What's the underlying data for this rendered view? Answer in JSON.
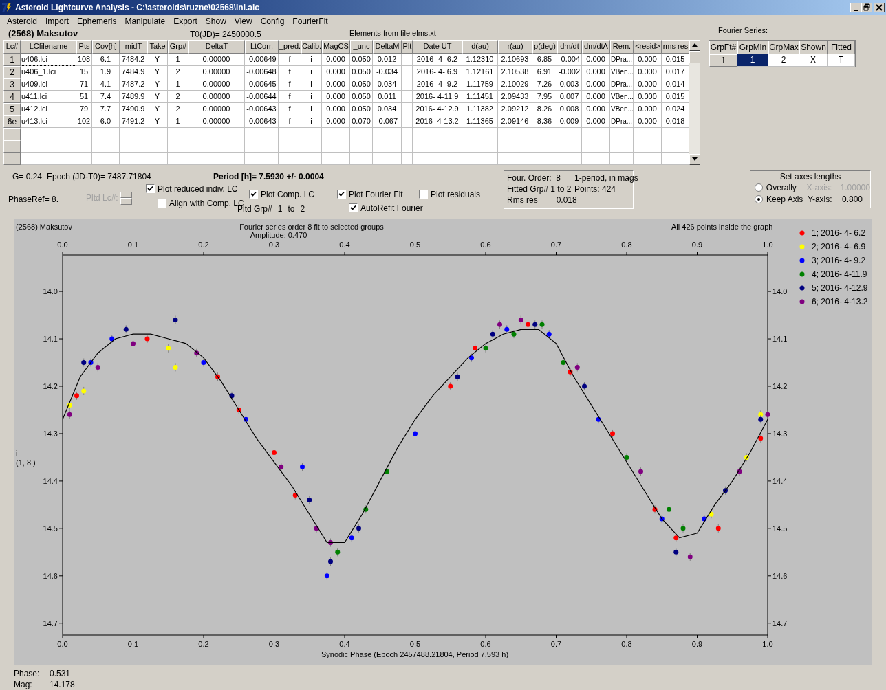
{
  "window": {
    "title": "Asteroid Lightcurve Analysis - C:\\asteroids\\ruzne\\02568\\ini.alc"
  },
  "menu": [
    "Asteroid",
    "Import",
    "Ephemeris",
    "Manipulate",
    "Export",
    "Show",
    "View",
    "Config",
    "FourierFit"
  ],
  "header": {
    "object": "(2568) Maksutov",
    "t0": "T0(JD)= 2450000.5",
    "elements": "Elements from file elms.xt"
  },
  "lc_table": {
    "columns": [
      "Lc#",
      "LCfilename",
      "Pts",
      "Cov[h]",
      "midT",
      "Take",
      "Grp#",
      "DeltaT",
      "LtCorr.",
      "_pred.",
      "Calib.",
      "MagCS",
      "_unc",
      "DeltaM",
      "Plt",
      "Date UT",
      "d(au)",
      "r(au)",
      "p(deg)",
      "dm/dt",
      "dm/dtA",
      "Rem.",
      "<resid>",
      "rms res"
    ],
    "rows": [
      {
        "focused": true,
        "cells": [
          "1",
          "u406.lci",
          "108",
          "6.1",
          "7484.2",
          "Y",
          "1",
          "0.00000",
          "-0.00649",
          "f",
          "i",
          "0.000",
          "0.050",
          "0.012",
          "",
          "2016- 4- 6.2",
          "1.12310",
          "2.10693",
          "6.85",
          "-0.004",
          "0.000",
          "DPra...",
          "0.000",
          "0.015"
        ]
      },
      {
        "focused": false,
        "cells": [
          "2",
          "u406_1.lci",
          "15",
          "1.9",
          "7484.9",
          "Y",
          "2",
          "0.00000",
          "-0.00648",
          "f",
          "i",
          "0.000",
          "0.050",
          "-0.034",
          "",
          "2016- 4- 6.9",
          "1.12161",
          "2.10538",
          "6.91",
          "-0.002",
          "0.000",
          "VBen...",
          "0.000",
          "0.017"
        ]
      },
      {
        "focused": false,
        "cells": [
          "3",
          "u409.lci",
          "71",
          "4.1",
          "7487.2",
          "Y",
          "1",
          "0.00000",
          "-0.00645",
          "f",
          "i",
          "0.000",
          "0.050",
          "0.034",
          "",
          "2016- 4- 9.2",
          "1.11759",
          "2.10029",
          "7.26",
          "0.003",
          "0.000",
          "DPra...",
          "0.000",
          "0.014"
        ]
      },
      {
        "focused": false,
        "cells": [
          "4",
          "u411.lci",
          "51",
          "7.4",
          "7489.9",
          "Y",
          "2",
          "0.00000",
          "-0.00644",
          "f",
          "i",
          "0.000",
          "0.050",
          "0.011",
          "",
          "2016- 4-11.9",
          "1.11451",
          "2.09433",
          "7.95",
          "0.007",
          "0.000",
          "VBen...",
          "0.000",
          "0.015"
        ]
      },
      {
        "focused": false,
        "cells": [
          "5",
          "u412.lci",
          "79",
          "7.7",
          "7490.9",
          "Y",
          "2",
          "0.00000",
          "-0.00643",
          "f",
          "i",
          "0.000",
          "0.050",
          "0.034",
          "",
          "2016- 4-12.9",
          "1.11382",
          "2.09212",
          "8.26",
          "0.008",
          "0.000",
          "VBen...",
          "0.000",
          "0.024"
        ]
      },
      {
        "focused": false,
        "cells": [
          "6e",
          "u413.lci",
          "102",
          "6.0",
          "7491.2",
          "Y",
          "1",
          "0.00000",
          "-0.00643",
          "f",
          "i",
          "0.000",
          "0.070",
          "-0.067",
          "",
          "2016- 4-13.2",
          "1.11365",
          "2.09146",
          "8.36",
          "0.009",
          "0.000",
          "DPra...",
          "0.000",
          "0.018"
        ]
      }
    ]
  },
  "fourier": {
    "label": "Fourier Series:",
    "columns": [
      "GrpFt#",
      "GrpMin",
      "GrpMax",
      "Shown",
      "Fitted"
    ],
    "rows": [
      {
        "cells": [
          {
            "text": "1",
            "kind": "header",
            "selected": false
          },
          {
            "text": "1",
            "kind": "cell",
            "selected": true
          },
          {
            "text": "2",
            "kind": "cell",
            "selected": false
          },
          {
            "text": "X",
            "kind": "cell",
            "selected": false
          },
          {
            "text": "T",
            "kind": "cell",
            "selected": false
          }
        ]
      }
    ]
  },
  "stats": {
    "g": "G= 0.24",
    "epoch": "Epoch (JD-T0)= 7487.71804",
    "period": "Period [h]= 7.5930 +/- 0.0004",
    "phaseref": "PhaseRef= 8.",
    "pltd_lc": {
      "label": "Pltd Lc#:",
      "disabled": true
    },
    "pltd_grp": [
      "Pltd Grp#",
      "1",
      "to",
      "2"
    ]
  },
  "checkboxes": [
    {
      "label": "Plot reduced indiv. LC",
      "checked": true
    },
    {
      "label": "Align with Comp. LC",
      "checked": false
    },
    {
      "label": "Plot Comp. LC",
      "checked": true
    },
    {
      "label": "Plot Fourier Fit",
      "checked": true
    },
    {
      "label": "AutoRefit Fourier",
      "checked": true
    },
    {
      "label": "Plot residuals",
      "checked": false
    }
  ],
  "fit_info": [
    "Four. Order:  8",
    "1-period, in mags",
    "Fitted Grp# 1 to 2",
    "Points: 424",
    "Rms res     = 0.018"
  ],
  "axes": {
    "title": "Set axes lengths",
    "options": [
      {
        "label": "Overally",
        "selected": false
      },
      {
        "label": "Keep Axis",
        "selected": true
      }
    ],
    "fields": [
      {
        "label": "X-axis:",
        "value": "1.00000",
        "disabled": true
      },
      {
        "label": "Y-axis:",
        "value": "0.800",
        "disabled": false
      }
    ]
  },
  "plot": {
    "chart_data": {
      "type": "scatter",
      "title": "Fourier series order 8 fit to selected groups",
      "xlabel": "Synodic Phase (Epoch 2457488.21804, Period 7.593 h)",
      "ylabel": "i",
      "legend": "right",
      "xlim": [
        0,
        1
      ],
      "ylim": [
        14.725,
        13.923
      ],
      "xticks": [
        {
          "value": 0,
          "label": "0.0"
        },
        {
          "value": 0.1,
          "label": "0.1"
        },
        {
          "value": 0.2,
          "label": "0.2"
        },
        {
          "value": 0.3,
          "label": "0.3"
        },
        {
          "value": 0.4,
          "label": "0.4"
        },
        {
          "value": 0.5,
          "label": "0.5"
        },
        {
          "value": 0.6,
          "label": "0.6"
        },
        {
          "value": 0.7,
          "label": "0.7"
        },
        {
          "value": 0.8,
          "label": "0.8"
        },
        {
          "value": 0.9,
          "label": "0.9"
        },
        {
          "value": 1,
          "label": "1.0"
        }
      ],
      "yticks": [
        {
          "value": 14,
          "label": "14.0"
        },
        {
          "value": 14.1,
          "label": "14.1"
        },
        {
          "value": 14.2,
          "label": "14.2"
        },
        {
          "value": 14.3,
          "label": "14.3"
        },
        {
          "value": 14.4,
          "label": "14.4"
        },
        {
          "value": 14.5,
          "label": "14.5"
        },
        {
          "value": 14.6,
          "label": "14.6"
        },
        {
          "value": 14.7,
          "label": "14.7"
        }
      ],
      "annotations": [
        "(2568) Maksutov",
        "Amplitude: 0.470",
        "All 426 points inside the graph",
        "(1, 8.)"
      ],
      "series": [
        {
          "name": "1; 2016- 4- 6.2",
          "color": "#ff0000",
          "x": [
            0.02,
            0.12,
            0.22,
            0.25,
            0.3,
            0.33,
            0.55,
            0.585,
            0.66,
            0.72,
            0.78,
            0.84,
            0.87,
            0.93,
            0.99
          ],
          "values": [
            14.22,
            14.1,
            14.18,
            14.25,
            14.34,
            14.43,
            14.2,
            14.12,
            14.07,
            14.17,
            14.3,
            14.46,
            14.52,
            14.5,
            14.31
          ]
        },
        {
          "name": "2; 2016- 4- 6.9",
          "color": "#ffff00",
          "x": [
            0.01,
            0.03,
            0.15,
            0.16,
            0.92,
            0.97,
            0.99
          ],
          "values": [
            14.24,
            14.21,
            14.12,
            14.16,
            14.47,
            14.35,
            14.26
          ]
        },
        {
          "name": "3; 2016- 4- 9.2",
          "color": "#0000ff",
          "x": [
            0.04,
            0.07,
            0.2,
            0.26,
            0.34,
            0.375,
            0.41,
            0.5,
            0.58,
            0.63,
            0.69,
            0.76,
            0.85,
            0.91
          ],
          "values": [
            14.15,
            14.1,
            14.15,
            14.27,
            14.37,
            14.6,
            14.52,
            14.3,
            14.14,
            14.08,
            14.09,
            14.27,
            14.48,
            14.48
          ]
        },
        {
          "name": "4; 2016- 4-11.9",
          "color": "#008000",
          "x": [
            0.39,
            0.43,
            0.46,
            0.6,
            0.64,
            0.68,
            0.71,
            0.8,
            0.86,
            0.88
          ],
          "values": [
            14.55,
            14.46,
            14.38,
            14.12,
            14.09,
            14.07,
            14.15,
            14.35,
            14.46,
            14.5
          ]
        },
        {
          "name": "5; 2016- 4-12.9",
          "color": "#000080",
          "x": [
            0.03,
            0.09,
            0.16,
            0.24,
            0.35,
            0.38,
            0.42,
            0.56,
            0.61,
            0.67,
            0.74,
            0.87,
            0.94,
            0.99
          ],
          "values": [
            14.15,
            14.08,
            14.06,
            14.22,
            14.44,
            14.57,
            14.5,
            14.18,
            14.09,
            14.07,
            14.2,
            14.55,
            14.42,
            14.27
          ]
        },
        {
          "name": "6; 2016- 4-13.2",
          "color": "#800080",
          "x": [
            0.01,
            0.05,
            0.1,
            0.19,
            0.31,
            0.36,
            0.38,
            0.62,
            0.65,
            0.73,
            0.82,
            0.89,
            0.96,
            1.0
          ],
          "values": [
            14.26,
            14.16,
            14.11,
            14.13,
            14.37,
            14.5,
            14.53,
            14.07,
            14.06,
            14.16,
            14.38,
            14.56,
            14.38,
            14.26
          ]
        },
        {
          "type": "line",
          "color": "#000000",
          "x": [
            0,
            0.025,
            0.05,
            0.075,
            0.1,
            0.125,
            0.15,
            0.175,
            0.2,
            0.225,
            0.25,
            0.275,
            0.3,
            0.325,
            0.35,
            0.375,
            0.4,
            0.425,
            0.45,
            0.475,
            0.5,
            0.525,
            0.55,
            0.575,
            0.6,
            0.625,
            0.65,
            0.675,
            0.7,
            0.725,
            0.75,
            0.775,
            0.8,
            0.825,
            0.85,
            0.875,
            0.9,
            0.925,
            0.95,
            0.975,
            1
          ],
          "values": [
            14.27,
            14.18,
            14.13,
            14.1,
            14.09,
            14.09,
            14.1,
            14.11,
            14.14,
            14.19,
            14.25,
            14.31,
            14.36,
            14.41,
            14.47,
            14.53,
            14.53,
            14.47,
            14.4,
            14.33,
            14.27,
            14.22,
            14.18,
            14.14,
            14.11,
            14.09,
            14.08,
            14.08,
            14.11,
            14.18,
            14.24,
            14.3,
            14.36,
            14.42,
            14.48,
            14.52,
            14.51,
            14.45,
            14.4,
            14.34,
            14.27
          ]
        }
      ]
    }
  },
  "status": [
    {
      "label": "Phase:",
      "value": "0.531"
    },
    {
      "label": "Mag:",
      "value": "14.178"
    }
  ]
}
